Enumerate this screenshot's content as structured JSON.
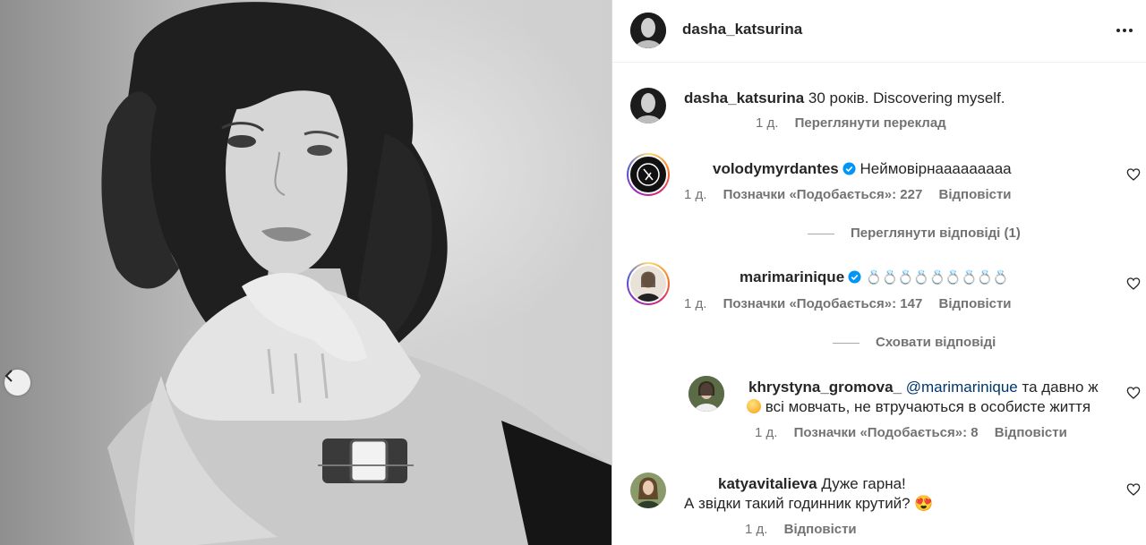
{
  "post": {
    "author": "dasha_katsurina",
    "caption": "30 років. Discovering myself.",
    "caption_time": "1 д.",
    "see_translation": "Переглянути переклад"
  },
  "comments": [
    {
      "user": "volodymyrdantes",
      "verified": true,
      "text": "Неймовірнааааааааа",
      "time": "1 д.",
      "likes": "Позначки «Подобається»: 227",
      "reply": "Відповісти",
      "thread_toggle": "Переглянути відповіді (1)"
    },
    {
      "user": "marimarinique",
      "verified": true,
      "text": "💍💍💍💍💍💍💍💍💍",
      "time": "1 д.",
      "likes": "Позначки «Подобається»: 147",
      "reply": "Відповісти",
      "thread_toggle": "Сховати відповіді"
    },
    {
      "user": "khrystyna_gromova_",
      "mention": "@marimarinique",
      "text_line1": "та давно ж",
      "text_line2": "всі мовчать, не втручаються в особисте життя",
      "time": "1 д.",
      "likes": "Позначки «Подобається»: 8",
      "reply": "Відповісти"
    },
    {
      "user": "katyavitalieva",
      "text_line1": "Дуже гарна!",
      "text_line2": "А звідки такий годинник крутий? 😍",
      "time": "1 д.",
      "reply": "Відповісти"
    }
  ]
}
